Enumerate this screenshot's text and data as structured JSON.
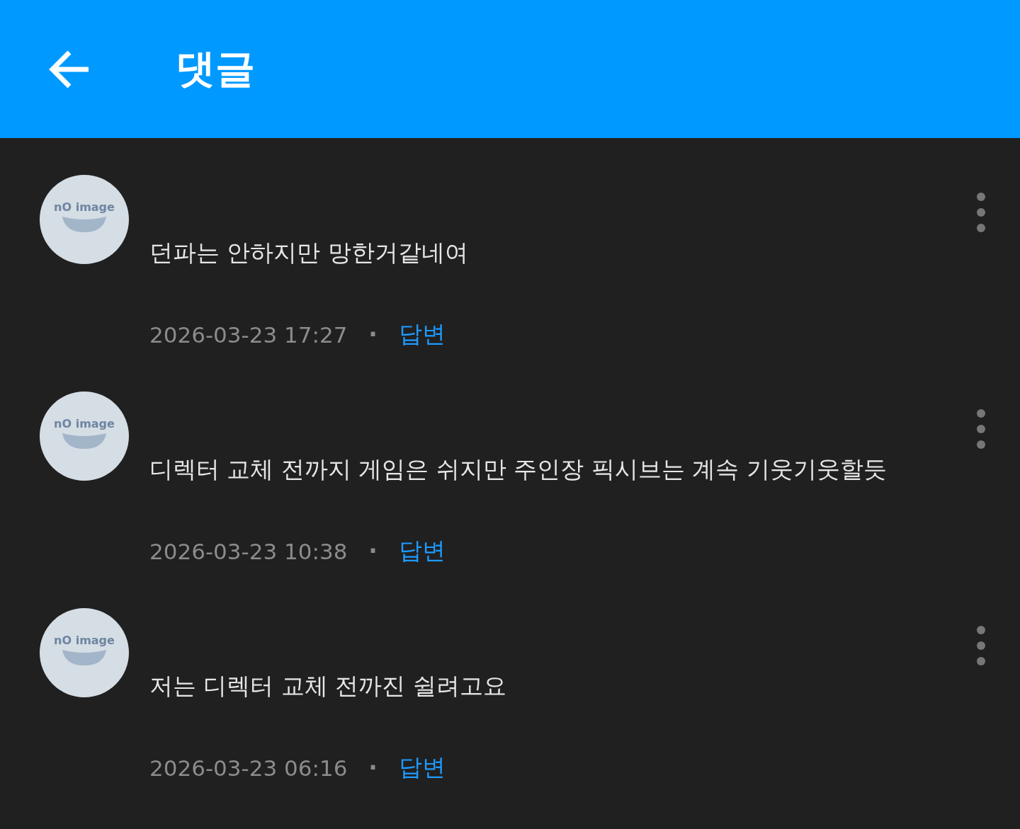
{
  "header": {
    "title": "댓글"
  },
  "comments": [
    {
      "avatar_label": "nO image",
      "text": "던파는 안하지만 망한거같네여",
      "date": "2026-03-23 17:27",
      "separator": "·",
      "reply": "답변"
    },
    {
      "avatar_label": "nO image",
      "text": "디렉터 교체 전까지 게임은 쉬지만 주인장 픽시브는 계속 기웃기웃할듯",
      "date": "2026-03-23 10:38",
      "separator": "·",
      "reply": "답변"
    },
    {
      "avatar_label": "nO image",
      "text": "저는 디렉터 교체 전까진 쉴려고요",
      "date": "2026-03-23 06:16",
      "separator": "·",
      "reply": "답변"
    }
  ]
}
